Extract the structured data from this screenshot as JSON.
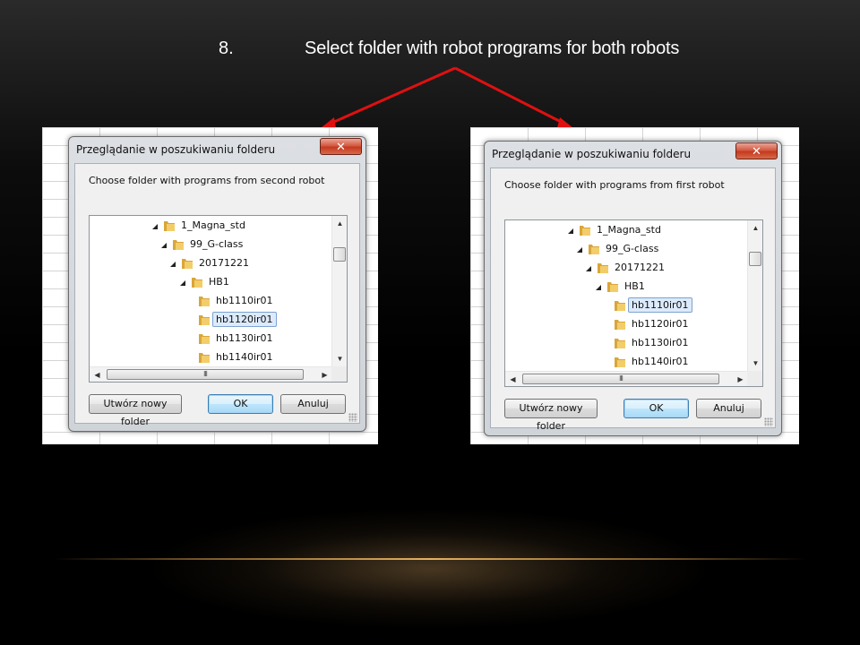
{
  "slide": {
    "step_number": "8.",
    "title": "Select folder with robot programs for both robots"
  },
  "dialogs": [
    {
      "title": "Przeglądanie w poszukiwaniu folderu",
      "close_glyph": "✕",
      "instruction": "Choose folder with programs from second robot",
      "tree": [
        {
          "label": "1_Magna_std",
          "expanded": true,
          "depth": 0
        },
        {
          "label": "99_G-class",
          "expanded": true,
          "depth": 1
        },
        {
          "label": "20171221",
          "expanded": true,
          "depth": 2
        },
        {
          "label": "HB1",
          "expanded": true,
          "depth": 3
        },
        {
          "label": "hb1110ir01",
          "depth": 4
        },
        {
          "label": "hb1120ir01",
          "depth": 4,
          "selected": true
        },
        {
          "label": "hb1130ir01",
          "depth": 4
        },
        {
          "label": "hb1140ir01",
          "depth": 4
        }
      ],
      "scroll_thumb_glyph": "III",
      "buttons": {
        "new_folder": "Utwórz nowy folder",
        "ok": "OK",
        "cancel": "Anuluj"
      }
    },
    {
      "title": "Przeglądanie w poszukiwaniu folderu",
      "close_glyph": "✕",
      "instruction": "Choose folder with programs from first robot",
      "tree": [
        {
          "label": "1_Magna_std",
          "expanded": true,
          "depth": 0
        },
        {
          "label": "99_G-class",
          "expanded": true,
          "depth": 1
        },
        {
          "label": "20171221",
          "expanded": true,
          "depth": 2
        },
        {
          "label": "HB1",
          "expanded": true,
          "depth": 3
        },
        {
          "label": "hb1110ir01",
          "depth": 4,
          "selected": true
        },
        {
          "label": "hb1120ir01",
          "depth": 4
        },
        {
          "label": "hb1130ir01",
          "depth": 4
        },
        {
          "label": "hb1140ir01",
          "depth": 4
        }
      ],
      "scroll_thumb_glyph": "III",
      "buttons": {
        "new_folder": "Utwórz nowy folder",
        "ok": "OK",
        "cancel": "Anuluj"
      }
    }
  ],
  "colors": {
    "arrow": "#e01010",
    "folder": "#e8b84a",
    "selection": "#dceafc"
  },
  "icons": {
    "close": "close-icon",
    "folder": "folder-icon",
    "expand": "expanded-triangle-icon",
    "up": "scroll-up-icon",
    "down": "scroll-down-icon",
    "left": "scroll-left-icon",
    "right": "scroll-right-icon"
  }
}
